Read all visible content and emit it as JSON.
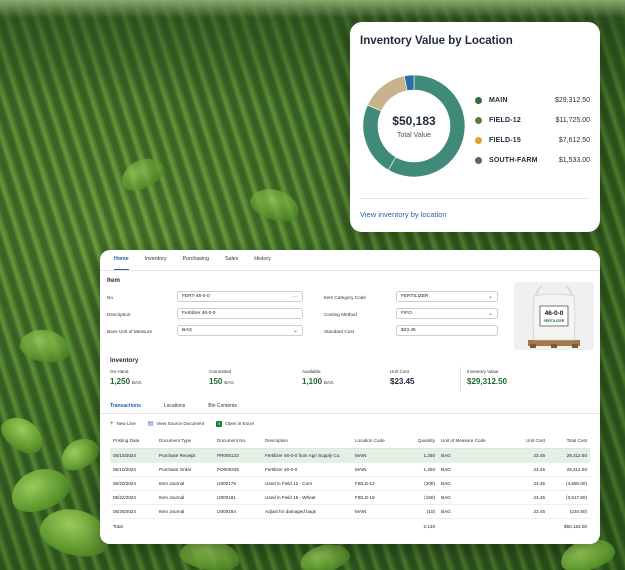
{
  "value_card": {
    "title": "Inventory Value by Location",
    "total_value": "$50,183",
    "total_label": "Total Value",
    "link": "View inventory by location",
    "locations": [
      {
        "name": "MAIN",
        "value": "$29,312.50",
        "amount": 29312.5,
        "color": "#2f6e3f"
      },
      {
        "name": "FIELD-12",
        "value": "$11,725.00",
        "amount": 11725,
        "color": "#5c7d3b"
      },
      {
        "name": "FIELD-15",
        "value": "$7,612.50",
        "amount": 7612.5,
        "color": "#e2a02d"
      },
      {
        "name": "SOUTH-FARM",
        "value": "$1,533.00",
        "amount": 1533,
        "color": "#5d6369"
      }
    ],
    "donut_segments": [
      {
        "amount": 29312.5,
        "color": "#3f8a78"
      },
      {
        "amount": 11725,
        "color": "#3f8a78"
      },
      {
        "amount": 7612.5,
        "color": "#c8b48c"
      },
      {
        "amount": 1533,
        "color": "#2a6fa8"
      }
    ]
  },
  "nav_tabs": [
    "Home",
    "Inventory",
    "Purchasing",
    "Sales",
    "History"
  ],
  "item": {
    "section_title": "Item",
    "no_label": "No.",
    "no_value": "FERT-46-0-0",
    "no_more": "···",
    "description_label": "Description",
    "description_value": "Fertilizer 46-0-0",
    "base_uom_label": "Base Unit of Measure",
    "base_uom_value": "BAG",
    "category_label": "Item Category Code",
    "category_value": "FERTILIZER",
    "costing_label": "Costing Method",
    "costing_value": "FIFO",
    "standard_cost_label": "Standard Cost",
    "standard_cost_value": "$23.45",
    "bag_label_top": "46-0-0",
    "bag_label_bottom": "FERTILIZER"
  },
  "inventory": {
    "section_title": "Inventory",
    "on_hand_label": "On Hand",
    "on_hand_value": "1,250",
    "on_hand_unit": "BAG",
    "committed_label": "Committed",
    "committed_value": "150",
    "committed_unit": "BAG",
    "available_label": "Available",
    "available_value": "1,100",
    "available_unit": "BAG",
    "unit_cost_label": "Unit Cost",
    "unit_cost_value": "$23.45",
    "inv_value_label": "Inventory Value",
    "inv_value_value": "$29,312.50"
  },
  "sub_tabs": [
    "Transactions",
    "Locations",
    "Bin Contents"
  ],
  "toolbar": {
    "new_line": "New Line",
    "view_source": "View Source Document",
    "open_excel": "Open in Excel"
  },
  "table": {
    "headers": [
      "Posting Date",
      "Document Type",
      "Document No.",
      "Description",
      "Location Code",
      "Quantity",
      "Unit of Measure Code",
      "Unit Cost",
      "Total Cost"
    ],
    "rows": [
      [
        "05/15/2024",
        "Purchase Receipt",
        "PR000123",
        "Fertilizer 46-0-0 from Agri Supply Co.",
        "MAIN",
        "1,250",
        "BAG",
        "23.45",
        "29,312.50"
      ],
      [
        "05/10/2024",
        "Purchase Order",
        "PO000345",
        "Fertilizer 46-0-0",
        "MAIN",
        "1,250",
        "BAG",
        "23.45",
        "29,312.50"
      ],
      [
        "05/20/2024",
        "Item Journal",
        "IJ000178",
        "Used in Field 12 - Corn",
        "FIELD-12",
        "(200)",
        "BAG",
        "23.45",
        "(4,690.00)"
      ],
      [
        "05/22/2024",
        "Item Journal",
        "IJ000181",
        "Used in Field 15 - Wheat",
        "FIELD-15",
        "(150)",
        "BAG",
        "23.45",
        "(3,517.50)"
      ],
      [
        "05/25/2024",
        "Item Journal",
        "IJ000184",
        "Adjust for damaged bags",
        "MAIN",
        "(10)",
        "BAG",
        "23.45",
        "(234.50)"
      ]
    ],
    "total_label": "Total",
    "total_quantity": "2,140",
    "total_cost": "$50,183.00"
  }
}
